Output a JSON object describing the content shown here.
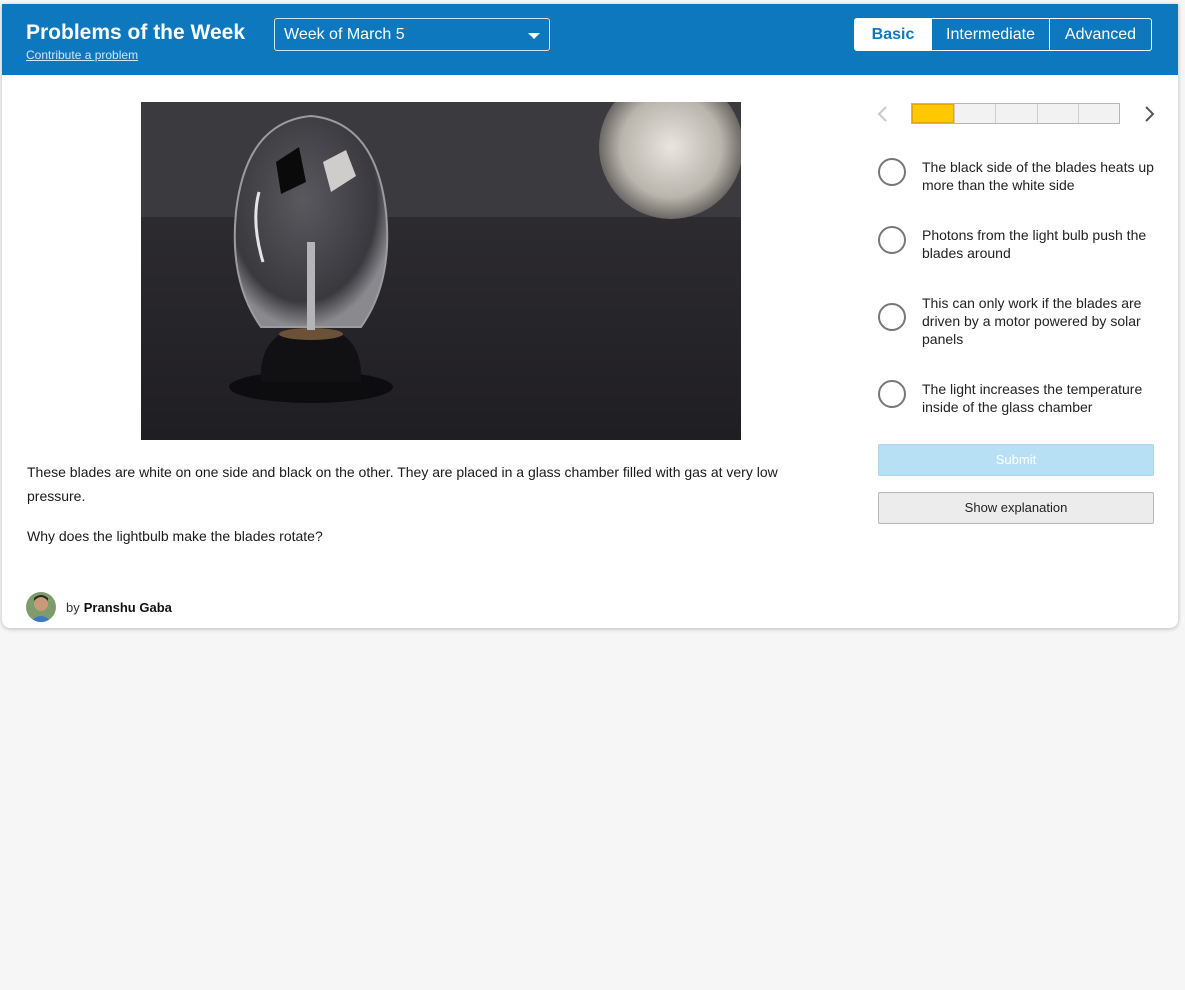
{
  "header": {
    "title": "Problems of the Week",
    "contribute_link": "Contribute a problem",
    "week_select": {
      "value": "Week of March 5"
    },
    "levels": [
      {
        "label": "Basic",
        "active": true
      },
      {
        "label": "Intermediate",
        "active": false
      },
      {
        "label": "Advanced",
        "active": false
      }
    ]
  },
  "problem": {
    "image": "crookes-radiometer-lightbulb-photo",
    "text": "These blades are white on one side and black on the other. They are placed in a glass chamber filled with gas at very low pressure.",
    "question": "Why does the lightbulb make the blades rotate?",
    "author": {
      "by": "by",
      "name": "Pranshu Gaba"
    }
  },
  "navigator": {
    "current": 1,
    "total": 5,
    "active_color": "#ffc800"
  },
  "choices": [
    {
      "label": "The black side of the blades heats up more than the white side"
    },
    {
      "label": "Photons from the light bulb push the blades around"
    },
    {
      "label": "This can only work if the blades are driven by a motor powered by solar panels"
    },
    {
      "label": "The light increases the temperature inside of the glass chamber"
    }
  ],
  "actions": {
    "submit": "Submit",
    "show_explanation": "Show explanation"
  },
  "colors": {
    "header_bg": "#0e78be",
    "submit_disabled": "#b8e0f5"
  }
}
